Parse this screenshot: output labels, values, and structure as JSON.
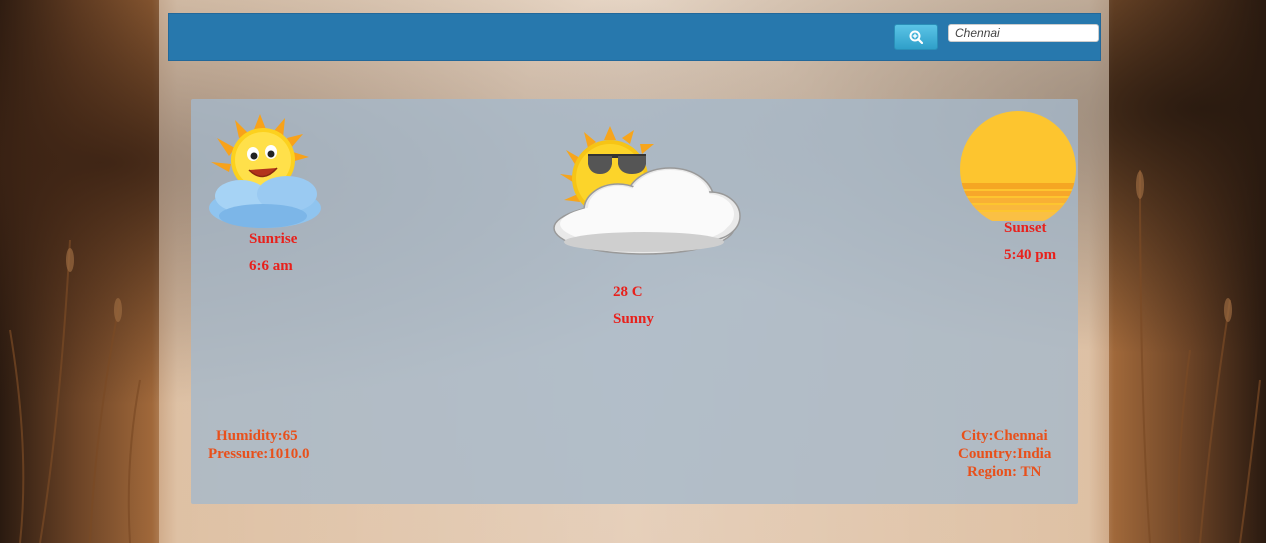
{
  "search": {
    "button_icon": "zoom-in-icon",
    "value": "Chennai",
    "placeholder": ""
  },
  "sunrise": {
    "label": "Sunrise",
    "time": "6:6 am",
    "icon": "smiling-sun-cloud-icon"
  },
  "current": {
    "temperature": "28 C",
    "condition": "Sunny",
    "icon": "sun-with-sunglasses-behind-cloud-icon"
  },
  "sunset": {
    "label": "Sunset",
    "time": "5:40 pm",
    "icon": "setting-sun-icon"
  },
  "details_left": {
    "humidity": "Humidity:65",
    "pressure": "Pressure:1010.0"
  },
  "details_right": {
    "city": "City:Chennai",
    "country": "Country:India",
    "region": "Region: TN"
  },
  "colors": {
    "navbar": "#2778ad",
    "text_red": "#e8201b",
    "card": "#a4b8cc"
  }
}
